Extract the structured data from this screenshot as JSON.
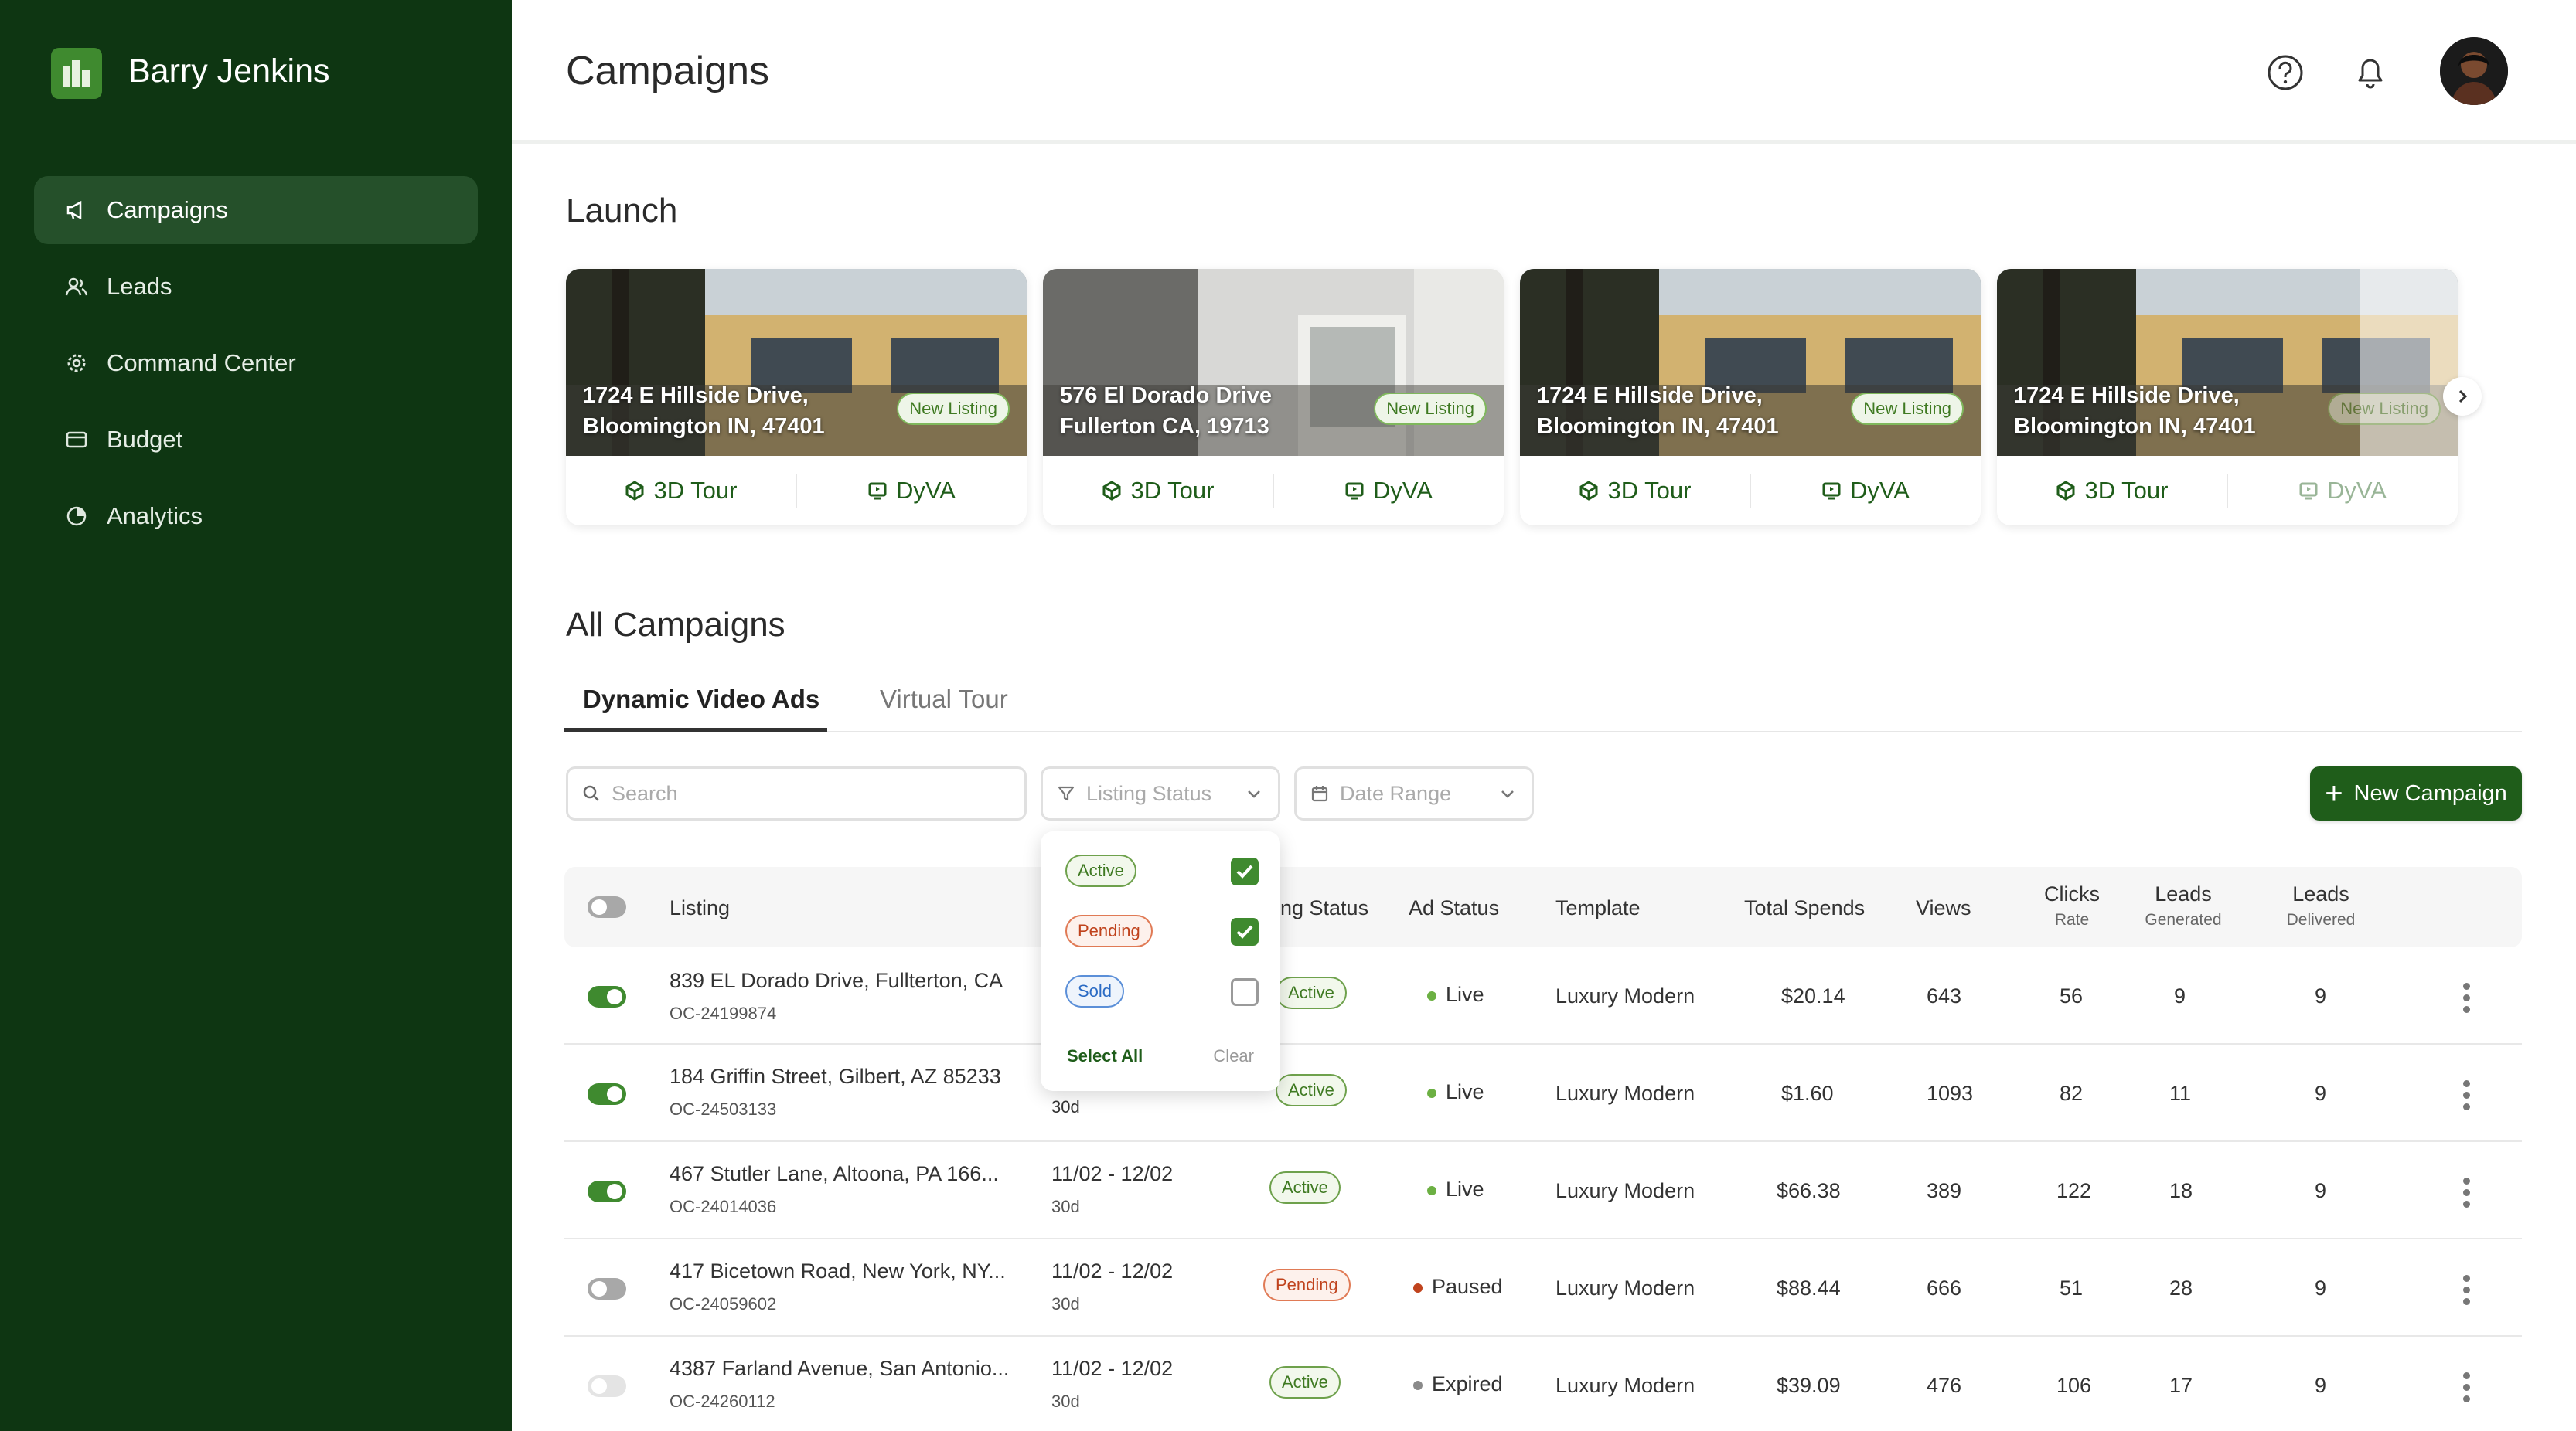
{
  "app": {
    "user_name": "Barry Jenkins"
  },
  "sidebar": {
    "items": [
      {
        "label": "Campaigns",
        "icon": "megaphone-icon",
        "active": true
      },
      {
        "label": "Leads",
        "icon": "users-icon",
        "active": false
      },
      {
        "label": "Command Center",
        "icon": "gear-icon",
        "active": false
      },
      {
        "label": "Budget",
        "icon": "credit-card-icon",
        "active": false
      },
      {
        "label": "Analytics",
        "icon": "pie-chart-icon",
        "active": false
      }
    ]
  },
  "header": {
    "title": "Campaigns",
    "help_icon": "help-icon",
    "bell_icon": "bell-icon",
    "avatar": "user-avatar"
  },
  "launch": {
    "title": "Launch",
    "cards": [
      {
        "address_line1": "1724 E Hillside Drive,",
        "address_line2": "Bloomington IN, 47401",
        "badge": "New Listing",
        "action1": "3D Tour",
        "action2": "DyVA"
      },
      {
        "address_line1": "576 El Dorado Drive",
        "address_line2": "Fullerton CA, 19713",
        "badge": "New Listing",
        "action1": "3D Tour",
        "action2": "DyVA"
      },
      {
        "address_line1": "1724 E Hillside Drive,",
        "address_line2": "Bloomington IN, 47401",
        "badge": "New Listing",
        "action1": "3D Tour",
        "action2": "DyVA"
      },
      {
        "address_line1": "1724 E Hillside Drive,",
        "address_line2": "Bloomington IN, 47401",
        "badge": "New Listing",
        "action1": "3D Tour",
        "action2": "DyVA"
      }
    ]
  },
  "campaigns": {
    "title": "All Campaigns",
    "tabs": [
      {
        "label": "Dynamic Video Ads",
        "active": true
      },
      {
        "label": "Virtual Tour",
        "active": false
      }
    ],
    "search_placeholder": "Search",
    "listing_status_placeholder": "Listing Status",
    "date_range_placeholder": "Date Range",
    "new_campaign_label": "New Campaign",
    "columns": {
      "listing": "Listing",
      "listing_status": "ing Status",
      "ad_status": "Ad Status",
      "template": "Template",
      "total_spends": "Total Spends",
      "views": "Views",
      "clicks": "Clicks",
      "clicks_sub": "Rate",
      "leads_gen": "Leads",
      "leads_gen_sub": "Generated",
      "leads_del": "Leads",
      "leads_del_sub": "Delivered"
    },
    "rows": [
      {
        "toggle": "on",
        "listing": "839 EL Dorado Drive, Fullterton, CA",
        "id": "OC-24199874",
        "date": "",
        "duration": "",
        "listing_status": "Active",
        "ad_status": "Live",
        "template": "Luxury Modern",
        "spends": "$20.14",
        "views": "643",
        "clicks": "56",
        "leads_gen": "9",
        "leads_del": "9"
      },
      {
        "toggle": "on",
        "listing": "184 Griffin Street, Gilbert, AZ 85233",
        "id": "OC-24503133",
        "date": "",
        "duration": "30d",
        "listing_status": "Active",
        "ad_status": "Live",
        "template": "Luxury Modern",
        "spends": "$1.60",
        "views": "1093",
        "clicks": "82",
        "leads_gen": "11",
        "leads_del": "9"
      },
      {
        "toggle": "on",
        "listing": "467 Stutler Lane, Altoona, PA 166...",
        "id": "OC-24014036",
        "date": "11/02 - 12/02",
        "duration": "30d",
        "listing_status": "Active",
        "ad_status": "Live",
        "template": "Luxury Modern",
        "spends": "$66.38",
        "views": "389",
        "clicks": "122",
        "leads_gen": "18",
        "leads_del": "9"
      },
      {
        "toggle": "off",
        "listing": "417 Bicetown Road, New York, NY...",
        "id": "OC-24059602",
        "date": "11/02 - 12/02",
        "duration": "30d",
        "listing_status": "Pending",
        "ad_status": "Paused",
        "template": "Luxury Modern",
        "spends": "$88.44",
        "views": "666",
        "clicks": "51",
        "leads_gen": "28",
        "leads_del": "9"
      },
      {
        "toggle": "disabled",
        "listing": "4387 Farland Avenue, San Antonio...",
        "id": "OC-24260112",
        "date": "11/02 - 12/02",
        "duration": "30d",
        "listing_status": "Active",
        "ad_status": "Expired",
        "template": "Luxury Modern",
        "spends": "$39.09",
        "views": "476",
        "clicks": "106",
        "leads_gen": "17",
        "leads_del": "9"
      }
    ],
    "status_dropdown": {
      "options": [
        {
          "label": "Active",
          "checked": true
        },
        {
          "label": "Pending",
          "checked": true
        },
        {
          "label": "Sold",
          "checked": false
        }
      ],
      "select_all": "Select All",
      "clear": "Clear"
    }
  },
  "colors": {
    "sidebar": "#0e3612",
    "accent": "#1f5d1a",
    "live": "#6cb043",
    "paused": "#c0431d",
    "expired": "#8a8a8a"
  }
}
